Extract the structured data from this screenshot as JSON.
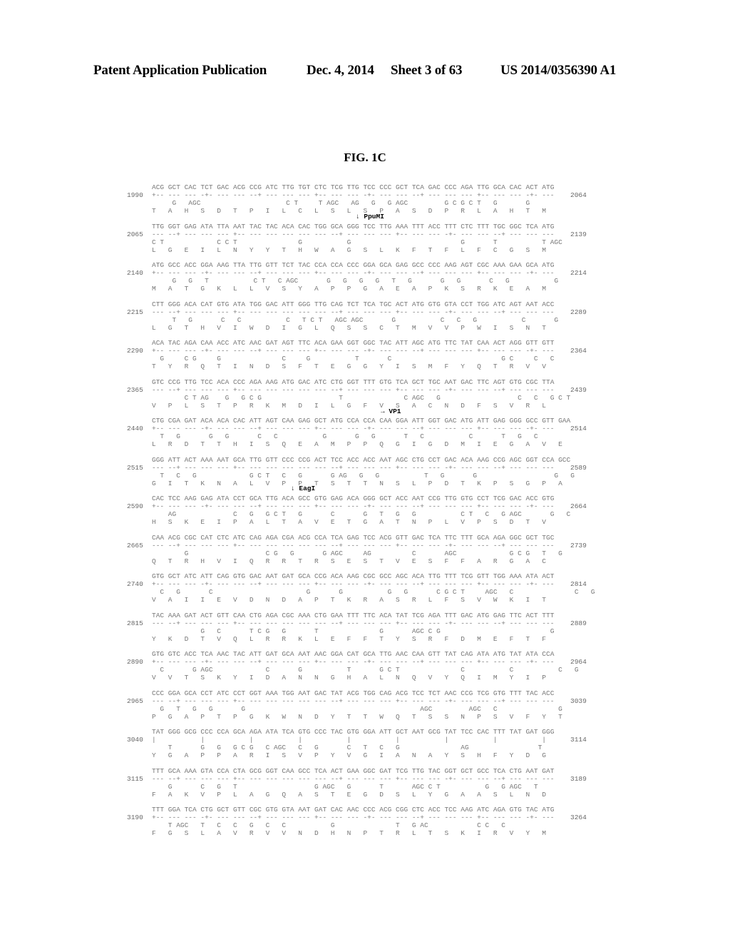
{
  "header": {
    "title": "Patent Application Publication",
    "date": "Dec. 4, 2014",
    "sheet": "Sheet 3 of 63",
    "number": "US 2014/0356390 A1"
  },
  "figure": {
    "label": "FIG. 1C"
  },
  "annotations": {
    "ppumi": "↓ PpuMI",
    "vp1": "→ VP1",
    "eagi": "↓ EagI"
  },
  "blocks": [
    {
      "start": "1990",
      "end": "2064",
      "seq": "ACG GCT CAC TCT GAC ACG CCG ATC TTG TGT CTC TCG TTG TCC CCC GCT TCA GAC CCC AGA TTG GCA CAC ACT ATG",
      "ticks": "+-- --- --- -+- --- --- --+ --- --- --- +-- --- --- -+- --- --- --+ --- --- --- +-- --- --- -+- ---",
      "alt": "     G   AGC                     C T     T AGC   AG   G   G AGC         G C G C T   G       G",
      "aa": "T   A   H   S   D   T   P   I   L   C   L   S   L   S   P   A   S   D   P   R   L   A   H   T   M"
    },
    {
      "start": "2065",
      "end": "2139",
      "seq": "TTG GGT GAG ATA TTA AAT TAC TAC ACA CAC TGG GCA GGG TCC TTG AAA TTT ACC TTT CTC TTT TGC GGC TCA ATG",
      "ticks": "--- --+ --- --- --- +-- --- --- --- --- --- --+ --- --- --- +-- --- --- -+- --- --- --+ --- --- ---",
      "alt": "C T             C C T               G           G                           G       T           T AGC",
      "aa": "L   G   E   I   L   N   Y   Y   T   H   W   A   G   S   L   K   F   T   F   L   F   C   G   S   M"
    },
    {
      "start": "2140",
      "end": "2214",
      "seq": "ATG GCC ACC GGA AAG TTA TTG GTT TCT TAC CCA CCA CCC GGA GCA GAG GCC CCC AAG AGT CGC AAA GAA GCA ATG",
      "ticks": "+-- --- --- -+- --- --- --+ --- --- --- +-- --- --- -+- --- --- --+ --- --- --- +-- --- --- -+- ---",
      "alt": "     G   G   T           C T   C AGC       G   G   G   G   T   G       G   G       C   G           G",
      "aa": "M   A   T   G   K   L   L   V   S   Y   A   P   P   G   A   E   A   P   K   S   R   K   E   A   M"
    },
    {
      "start": "2215",
      "end": "2289",
      "seq": "CTT GGG ACA CAT GTG ATA TGG GAC ATT GGG TTG CAG TCT TCA TGC ACT ATG GTG GTA CCT TGG ATC AGT AAT ACC",
      "ticks": "--- --+ --- --- --- +-- --- --- --- --- --- --+ --- --- --- +-- --- --- -+- --- --- --+ --- --- ---",
      "alt": "     T   G       C   C           C   T C T   AGC AGC       G           C   C   G           C       G",
      "aa": "L   G   T   H   V   I   W   D   I   G   L   Q   S   S   C   T   M   V   V   P   W   I   S   N   T"
    },
    {
      "start": "2290",
      "end": "2364",
      "seq": "ACA TAC AGA CAA ACC ATC AAC GAT AGT TTC ACA GAA GGT GGC TAC ATT AGC ATG TTC TAT CAA ACT AGG GTT GTT",
      "ticks": "+-- --- --- -+- --- --- --+ --- --- --- +-- --- --- -+- --- --- --+ --- --- --- +-- --- --- -+- ---",
      "alt": "  G     C G     G               C     G           T       C                           G C     C   C",
      "aa": "T   Y   R   Q   T   I   N   D   S   F   T   E   G   G   Y   I   S   M   F   Y   Q   T   R   V   V"
    },
    {
      "start": "2365",
      "end": "2439",
      "seq": "GTC CCG TTG TCC ACA CCC AGA AAG ATG GAC ATC CTG GGT TTT GTG TCA GCT TGC AAT GAC TTC AGT GTG CGC TTA",
      "ticks": "--- --+ --- --- --- +-- --- --- --- --- --- --+ --- --- --- +-- --- --- -+- --- --- --+ --- --- ---",
      "alt": "        C T AG    G   G C G                   T               C AGC   G                   C   C   G C T",
      "aa": "V   P   L   S   T   P   R   K   M   D   I   L   G   F   V   S   A   C   N   D   F   S   V   R   L"
    },
    {
      "start": "2440",
      "end": "2514",
      "seq": "CTG CGA GAT ACA ACA CAC ATT AGT CAA GAG GCT ATG CCA CCA CAA GGA ATT GGT GAC ATG ATT GAG GGG GCC GTT GAA",
      "ticks": "+-- --- --- -+- --- --- --+ --- --- --- +-- --- --- -+- --- --- --+ --- --- --- +-- --- --- -+- ---",
      "alt": "  T   G       G   G       C   C           G       G   G       T   C           C       T   G   C",
      "aa": "L   R   D   T   T   H   I   S   Q   E   A   M   P   P   Q   G   I   G   D   M   I   E   G   A   V   E"
    },
    {
      "start": "2515",
      "end": "2589",
      "seq": "GGG ATT ACT AAA AAT GCA TTG GTT CCC CCG ACT TCC ACC ACC AAT AGC CTG CCT GAC ACA AAG CCG AGC GGT CCA GCC",
      "ticks": "--- --+ --- --- --- +-- --- --- --- --- --- --+ --- --- --- +-- --- --- -+- --- --- --+ --- --- ---",
      "alt": "  T   C   G             G C T   C   G       G AG   G   G           T   G       G                   G   G",
      "aa": "G   I   T   K   N   A   L   V   P   P   T   S   T   T   N   S   L   P   D   T   K   P   S   G   P   A"
    },
    {
      "start": "2590",
      "end": "2664",
      "seq": "CAC TCC AAG GAG ATA CCT GCA TTG ACA GCC GTG GAG ACA GGG GCT ACC AAT CCG TTG GTG CCT TCG GAC ACC GTG",
      "ticks": "+-- --- --- -+- --- --- --+ --- --- --- +-- --- --- -+- --- --- --+ --- --- --- +-- --- --- -+- ---",
      "alt": "    AG              C   G   G C T   G       C       G   T   G   G           C T   C   G AGC       G   C",
      "aa": "H   S   K   E   I   P   A   L   T   A   V   E   T   G   A   T   N   P   L   V   P   S   D   T   V"
    },
    {
      "start": "2665",
      "end": "2739",
      "seq": "CAA ACG CGC CAT CTC ATC CAG AGA CGA ACG CCA TCA GAG TCC ACG GTT GAC TCA TTC TTT GCA AGA GGC GCT TGC",
      "ticks": "--- --+ --- --- --- +-- --- --- --- --- --- --+ --- --- --- +-- --- --- -+- --- --- --+ --- --- ---",
      "alt": "        G                   C G   G       G AGC     AG          C       AGC             G C G   T   G",
      "aa": "Q   T   R   H   V   I   Q   R   R   T   R   S   E   S   T   V   E   S   F   F   A   R   G   A   C"
    },
    {
      "start": "2740",
      "end": "2814",
      "seq": "GTG GCT ATC ATT CAG GTG GAC AAT GAT GCA CCG ACA AAG CGC GCC AGC ACA TTG TTT TCG GTT TGG AAA ATA ACT",
      "ticks": "+-- --- --- -+- --- --- --+ --- --- --- +-- --- --- -+- --- --- --+ --- --- --- +-- --- --- -+- ---",
      "alt": "  C   G       C                       G       G           G   G       C G C T     AGC   C               C   G",
      "aa": "V   A   I   I   E   V   D   N   D   A   P   T   K   R   A   S   R   L   F   S   V   W   K   I   T"
    },
    {
      "start": "2815",
      "end": "2889",
      "seq": "TAC AAA GAT ACT GTT CAA CTG AGA CGC AAA CTG GAA TTT TTC ACA TAT TCG AGA TTT GAC ATG GAG TTC ACT TTT",
      "ticks": "--- --+ --- --- --- +-- --- --- --- --- --- --+ --- --- --- +-- --- --- -+- --- --- --+ --- --- ---",
      "alt": "            G   C       T C G   G       T               G       AGC C G                           G",
      "aa": "Y   K   D   T   V   Q   L   R   R   K   L   E   F   F   T   Y   S   R   F   D   M   E   F   T   F"
    },
    {
      "start": "2890",
      "end": "2964",
      "seq": "GTG GTC ACC TCA AAC TAC ATT GAT GCA AAT AAC GGA CAT GCA TTG AAC CAA GTT TAT CAG ATA ATG TAT ATA CCA",
      "ticks": "+-- --- --- -+- --- --- --+ --- --- --- +-- --- --- -+- --- --- --+ --- --- --- +-- --- --- -+- ---",
      "alt": "  C       G AGC             C       G           T       G C T               C           C           C   G",
      "aa": "V   V   T   S   K   Y   I   D   A   N   N   G   H   A   L   N   Q   V   Y   Q   I   M   Y   I   P"
    },
    {
      "start": "2965",
      "end": "3039",
      "seq": "CCC GGA GCA CCT ATC CCT GGT AAA TGG AAT GAC TAT ACG TGG CAG ACG TCC TCT AAC CCG TCG GTG TTT TAC ACC",
      "ticks": "--- --+ --- --- --- +-- --- --- --- --- --- --+ --- --- --- +-- --- --- -+- --- --- --+ --- --- ---",
      "alt": "  G   T   G   G       G                                           AGC         AGC   C               G",
      "aa": "P   G   A   P   T   P   G   K   W   N   D   Y   T   T   W   Q   T   S   S   N   P   S   V   F   Y   T"
    },
    {
      "start": "3040",
      "end": "3114",
      "seq": "TAT GGG GCG CCC CCA GCA AGA ATA TCA GTG CCC TAC GTG GGA ATT GCT AAT GCG TAT TCC CAC TTT TAT GAT GGG",
      "ticks": "|           |           |           |           |           |           |           |           |",
      "alt": "    T       G   G   G C G   C AGC   C   G       C   T   C   G               AG                 T",
      "aa": "Y   G   A   P   P   A   R   I   S   V   P   Y   V   G   I   A   N   A   Y   S   H   F   Y   D   G"
    },
    {
      "start": "3115",
      "end": "3189",
      "seq": "TTT GCA AAA GTA CCA CTA GCG GGT CAA GCC TCA ACT GAA GGC GAT TCG TTG TAC GGT GCT GCC TCA CTG AAT GAT",
      "ticks": "--- --+ --- --- --- +-- --- --- --- --- --- --+ --- --- --- +-- --- --- -+- --- --- --+ --- --- ---",
      "alt": "    G       C   G   T                   G AGC   G       T       AGC C T           G   G AGC   T",
      "aa": "F   A   K   V   P   L   A   G   Q   A   S   T   E   G   D   S   L   Y   G   A   A   S   L   N   D"
    },
    {
      "start": "3190",
      "end": "3264",
      "seq": "TTT GGA TCA CTG GCT GTT CGC GTG GTA AAT GAT CAC AAC CCC ACG CGG CTC ACC TCC AAG ATC AGA GTG TAC ATG",
      "ticks": "+-- --- --- -+- --- --- --+ --- --- --- +-- --- --- -+- --- --- --+ --- --- --- +-- --- --- -+- ---",
      "alt": "    T AGC   T   C   C   G   C   C           G               T   G AC            C C   C",
      "aa": "F   G   S   L   A   V   R   V   V   N   D   H   N   P   T   R   L   T   S   K   I   R   V   Y   M"
    }
  ]
}
